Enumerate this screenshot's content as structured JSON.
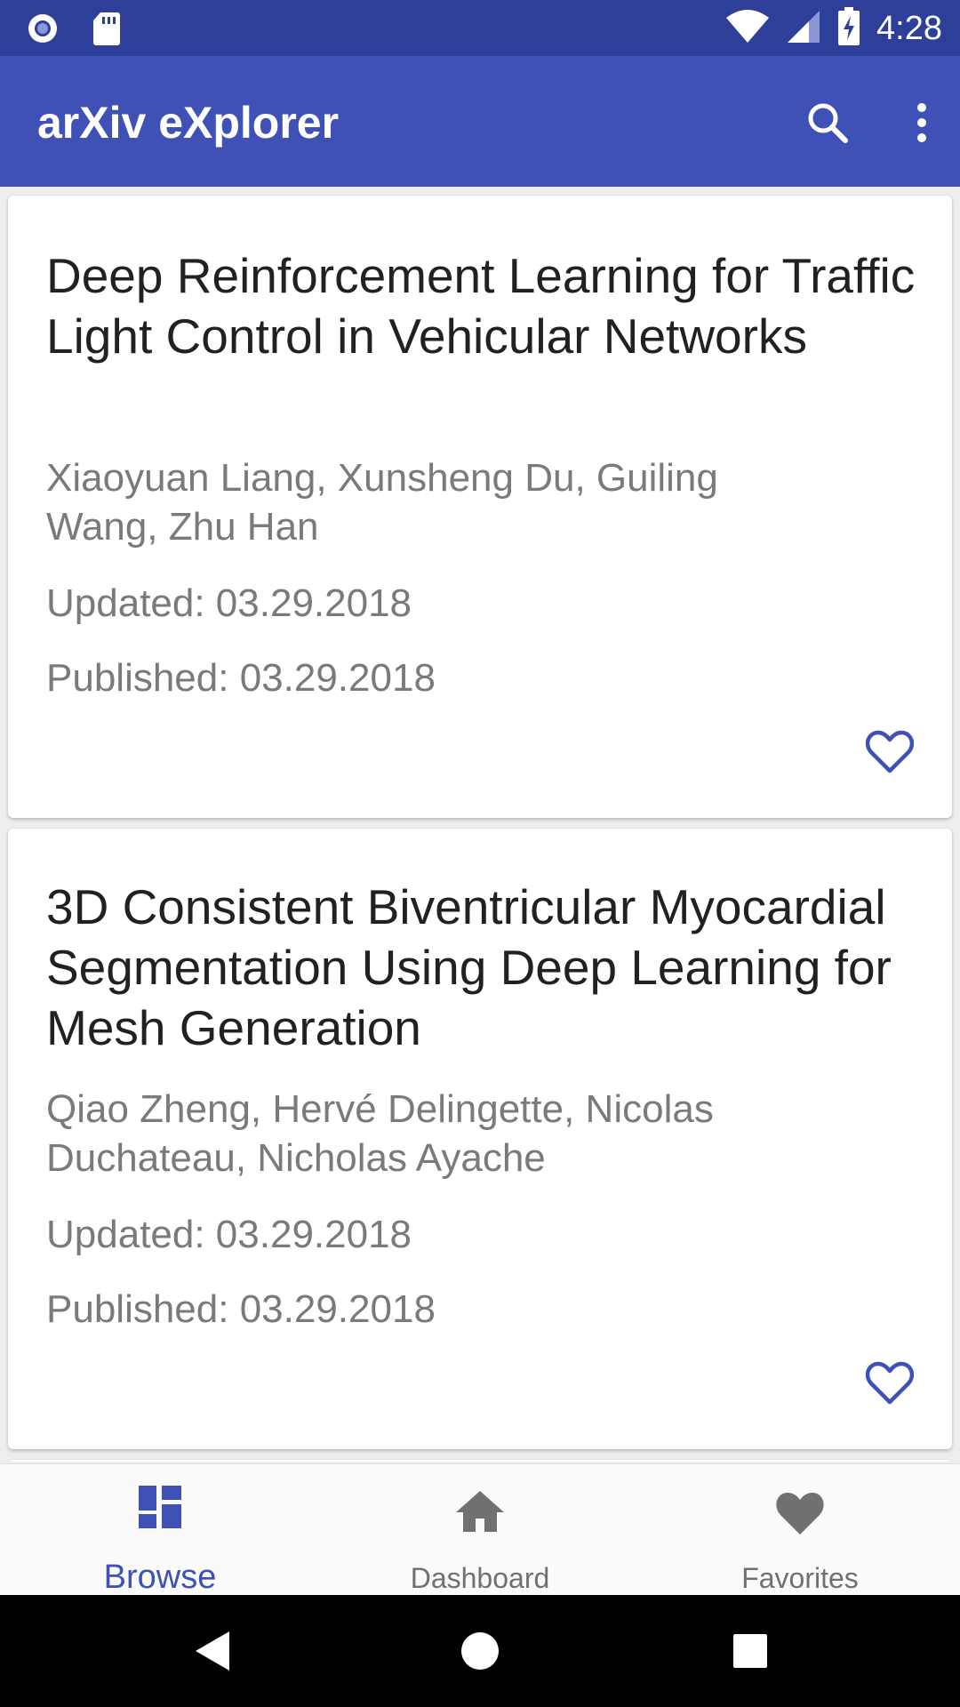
{
  "status_bar": {
    "time": "4:28",
    "left_icons": [
      "record-icon",
      "sd-card-icon"
    ],
    "right_icons": [
      "wifi-icon",
      "cellular-signal-icon",
      "battery-charging-icon"
    ]
  },
  "app_bar": {
    "title": "arXiv eXplorer",
    "actions": [
      "search-icon",
      "more-vert-icon"
    ]
  },
  "papers": [
    {
      "title": "Deep Reinforcement Learning for Traffic Light Control in Vehicular Networks",
      "authors": "Xiaoyuan Liang, Xunsheng Du, Guiling Wang, Zhu Han",
      "updated": "Updated: 03.29.2018",
      "published": "Published: 03.29.2018",
      "favorite_icon": "heart-outline-icon"
    },
    {
      "title": "3D Consistent Biventricular Myocardial Segmentation Using Deep Learning for Mesh Generation",
      "authors": "Qiao Zheng, Hervé Delingette, Nicolas Duchateau, Nicholas Ayache",
      "updated": "Updated: 03.29.2018",
      "published": "Published: 03.29.2018",
      "favorite_icon": "heart-outline-icon"
    }
  ],
  "bottom_nav": {
    "items": [
      {
        "label": "Browse",
        "icon": "dashboard-grid-icon",
        "active": true
      },
      {
        "label": "Dashboard",
        "icon": "home-icon",
        "active": false
      },
      {
        "label": "Favorites",
        "icon": "heart-icon",
        "active": false
      }
    ]
  },
  "system_nav": [
    "back-icon",
    "home-circle-icon",
    "recents-icon"
  ],
  "colors": {
    "primary": "#3f51b5",
    "primary_dark": "#2e3f99",
    "text_primary": "#212121",
    "text_secondary": "#7a7a7a",
    "nav_inactive": "#707070"
  }
}
